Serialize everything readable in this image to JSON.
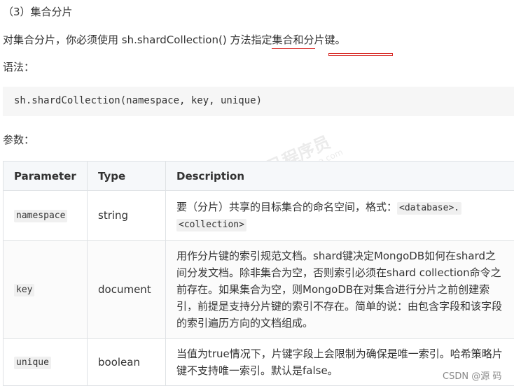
{
  "heading": "（3）集合分片",
  "intro": "对集合分片，你必须使用 sh.shardCollection() 方法指定集合和分片键。",
  "syntax_label": "语法：",
  "code": "sh.shardCollection(namespace, key, unique)",
  "params_label": "参数：",
  "table": {
    "headers": [
      "Parameter",
      "Type",
      "Description"
    ],
    "rows": [
      {
        "param": "namespace",
        "type": "string",
        "desc_text": "要（分片）共享的目标集合的命名空间，格式：",
        "desc_code1": "<database>.",
        "desc_code2": "<collection>"
      },
      {
        "param": "key",
        "type": "document",
        "desc_text": "用作分片键的索引规范文档。shard键决定MongoDB如何在shard之间分发文档。除非集合为空，否则索引必须在shard collection命令之前存在。如果集合为空，则MongoDB在对集合进行分片之前创建索引，前提是支持分片键的索引不存在。简单的说：由包含字段和该字段的索引遍历方向的文档组成。"
      },
      {
        "param": "unique",
        "type": "boolean",
        "desc_text": "当值为true情况下，片键字段上会限制为确保是唯一索引。哈希策略片键不支持唯一索引。默认是false。"
      }
    ]
  },
  "watermark": {
    "main": "黑马程序员",
    "sub": "www.itheima.com"
  },
  "footer": "CSDN @源 码",
  "colors": {
    "underline": "#d9302c",
    "code_bg": "#f6f6f6",
    "header_bg": "#f6f8fa",
    "border": "#dfe2e5"
  }
}
